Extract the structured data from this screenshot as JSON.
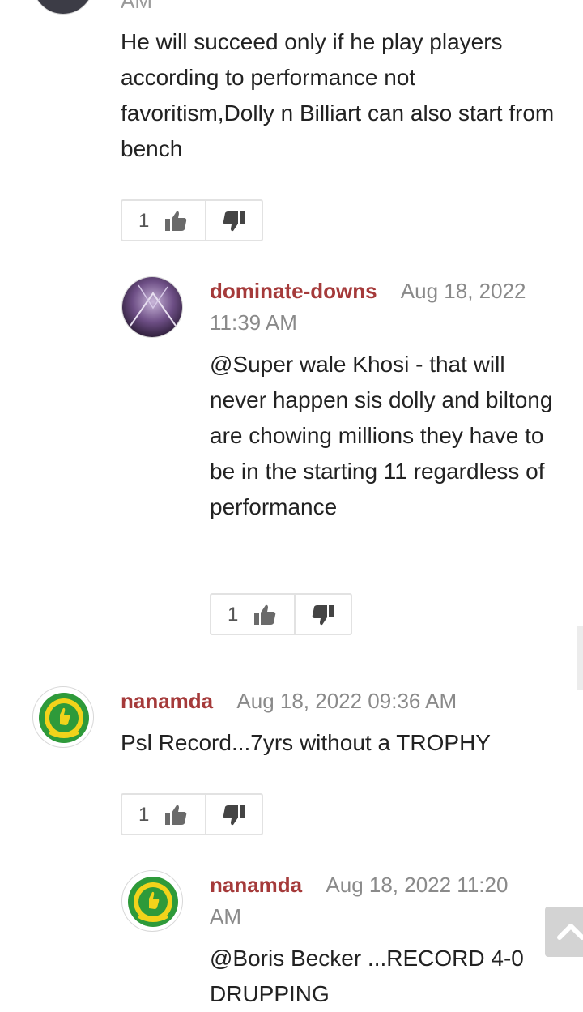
{
  "top_comment": {
    "time_tail": "AM",
    "text": "He will succeed only if he play players according to performance not favoritism,Dolly n Billiart can also start from bench",
    "likes": "1"
  },
  "reply1": {
    "username": "dominate-downs",
    "date": "Aug 18, 2022",
    "time": "11:39 AM",
    "text": "@Super wale Khosi - that will never happen sis dolly and biltong are chowing millions they have to be in the starting 11 regardless of performance",
    "likes": "1"
  },
  "comment2": {
    "username": "nanamda",
    "date": "Aug 18, 2022 09:36 AM",
    "text": "Psl Record...7yrs without a TROPHY",
    "likes": "1"
  },
  "reply2": {
    "username": "nanamda",
    "date": "Aug 18, 2022 11:20",
    "time": "AM",
    "text": "@Boris Becker ...RECORD 4-0 DRUPPING"
  },
  "icons": {
    "like": "thumbs-up-icon",
    "dislike": "thumbs-down-icon",
    "scroll_top": "chevron-up-icon"
  },
  "colors": {
    "username": "#a53a3a",
    "date": "#8a8a8a",
    "badge_green": "#2e9a3a",
    "badge_yellow": "#f2d31b"
  }
}
